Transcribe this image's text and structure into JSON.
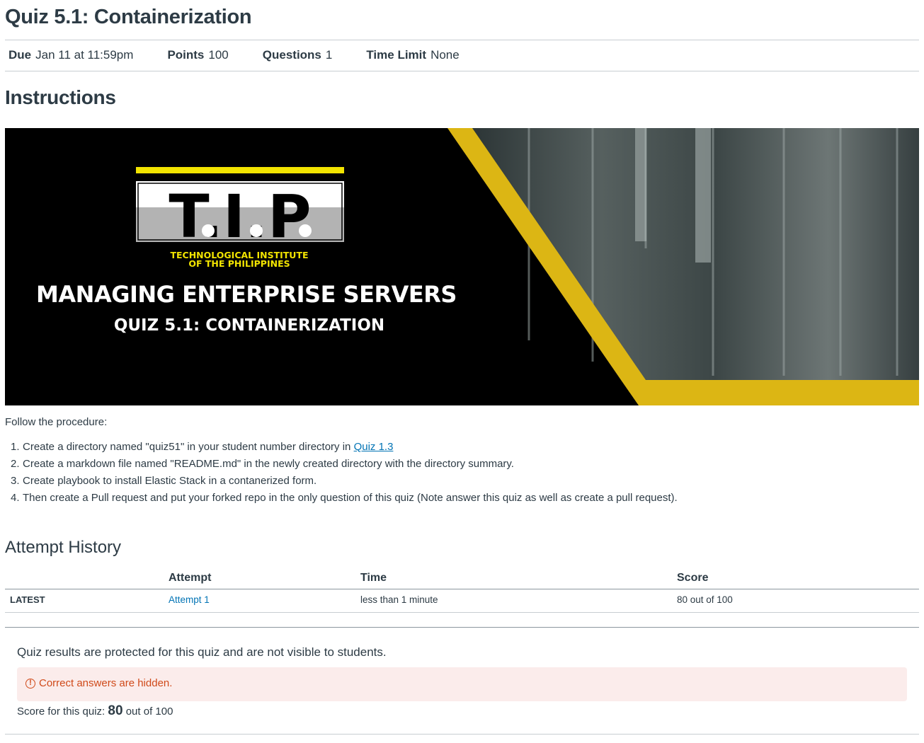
{
  "quiz": {
    "title": "Quiz 5.1: Containerization"
  },
  "meta": {
    "due_label": "Due",
    "due_value": "Jan 11 at 11:59pm",
    "points_label": "Points",
    "points_value": "100",
    "questions_label": "Questions",
    "questions_value": "1",
    "time_limit_label": "Time Limit",
    "time_limit_value": "None"
  },
  "instructions": {
    "heading": "Instructions",
    "banner": {
      "logo_text": "T.I.P",
      "institute_line1": "TECHNOLOGICAL INSTITUTE",
      "institute_line2": "OF THE PHILIPPINES",
      "course": "MANAGING ENTERPRISE SERVERS",
      "quiz": "QUIZ 5.1: CONTAINERIZATION",
      "accent_color": "#dcb614"
    },
    "intro": "Follow the procedure:",
    "steps": [
      {
        "num": "1.",
        "text": "Create a directory named \"quiz51\" in your student number directory in ",
        "link": "Quiz 1.3"
      },
      {
        "num": "2.",
        "text": "Create a markdown file named \"README.md\" in the newly created directory with the directory summary."
      },
      {
        "num": "3.",
        "text": "Create playbook to install Elastic Stack in a contanerized form."
      },
      {
        "num": "4.",
        "text": "Then create a Pull request and put your forked repo in the only question of this quiz (Note answer this quiz as well as create a pull request)."
      }
    ]
  },
  "attempt_history": {
    "heading": "Attempt History",
    "columns": [
      "Attempt",
      "Time",
      "Score"
    ],
    "rows": [
      {
        "tag": "LATEST",
        "attempt": "Attempt 1",
        "time": "less than 1 minute",
        "score": "80 out of 100"
      }
    ]
  },
  "results": {
    "protected_note": "Quiz results are protected for this quiz and are not visible to students.",
    "warning": "Correct answers are hidden.",
    "warning_color": "#d04a1a",
    "score_label": "Score for this quiz:",
    "score_value": "80",
    "score_suffix": "out of 100"
  },
  "link_color": "#0374b5"
}
